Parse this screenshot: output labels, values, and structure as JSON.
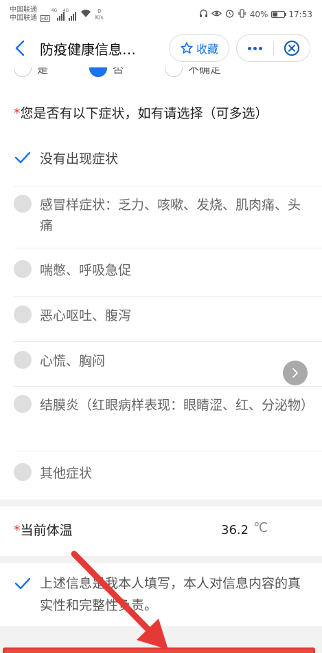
{
  "status_bar": {
    "carrier_1": "中国联通",
    "carrier_2": "中国联通",
    "hd_badge": "HD",
    "network_type_1": "4G",
    "network_type_2": "4G",
    "net_speed_value": "0",
    "net_speed_unit": "K/s",
    "battery_percent": "40%",
    "battery_level": 0.4,
    "time": "17:53"
  },
  "nav": {
    "title": "防疫健康信息…",
    "favorite_label": "收藏",
    "accent_color": "#1a73e8"
  },
  "previous_question": {
    "options": [
      "是",
      "否",
      "不确定"
    ],
    "selected_index": 1
  },
  "symptoms": {
    "required_mark": "*",
    "question": "您是否有以下症状，如有请选择（可多选）",
    "options": [
      {
        "label": "没有出现症状",
        "checked": true
      },
      {
        "label": "感冒样症状：乏力、咳嗽、发烧、肌肉痛、头痛",
        "checked": false
      },
      {
        "label": "喘憋、呼吸急促",
        "checked": false
      },
      {
        "label": "恶心呕吐、腹泻",
        "checked": false
      },
      {
        "label": "心慌、胸闷",
        "checked": false
      },
      {
        "label": "结膜炎（红眼病样表现：眼睛涩、红、分泌物）",
        "checked": false
      },
      {
        "label": "其他症状",
        "checked": false
      }
    ]
  },
  "temperature": {
    "required_mark": "*",
    "label": "当前体温",
    "value": "36.2",
    "unit": "℃"
  },
  "declaration": {
    "text": "上述信息是我本人填写，本人对信息内容的真实性和完整性负责。",
    "checked": true
  },
  "annotation": {
    "color": "#e53935"
  }
}
